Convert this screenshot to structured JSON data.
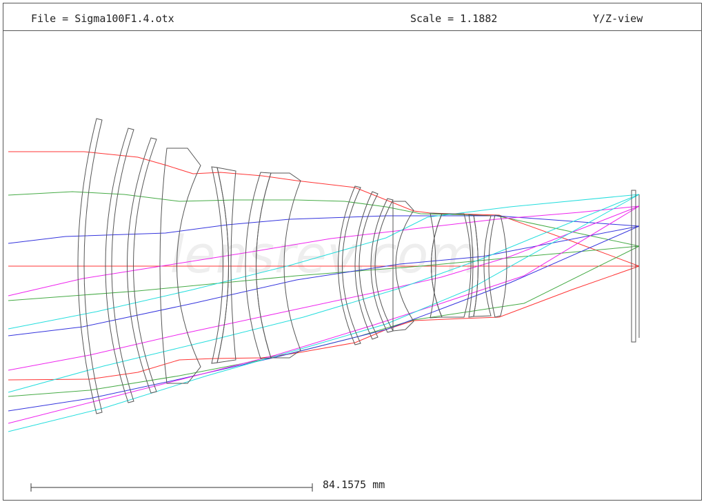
{
  "header": {
    "file_label": "File = Sigma100F1.4.otx",
    "scale_label": "Scale = 1.1882",
    "view_label": "Y/Z-view"
  },
  "scale_bar": {
    "label": "84.1575 mm"
  },
  "watermark": "lensrev.com",
  "colors": {
    "lens_outline": "#555555",
    "ray_red": "#ff3333",
    "ray_green": "#44aa44",
    "ray_blue": "#3333dd",
    "ray_magenta": "#ee22ee",
    "ray_cyan": "#22dddd",
    "frame": "#555555"
  }
}
